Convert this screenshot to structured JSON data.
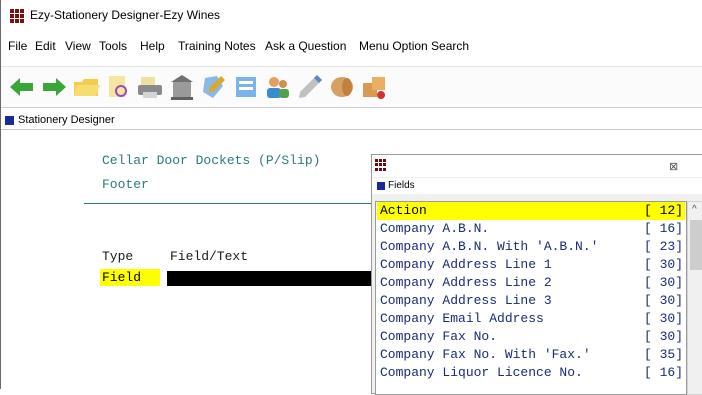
{
  "window": {
    "title": "Ezy-Stationery Designer-Ezy Wines"
  },
  "menu": [
    "File",
    "Edit",
    "View",
    "Tools",
    "Help",
    "Training Notes",
    "Ask a Question",
    "Menu Option Search"
  ],
  "toolbar": {
    "icons": [
      "back-arrow-icon",
      "forward-arrow-icon",
      "folder-icon",
      "search-doc-icon",
      "print-icon",
      "building-icon",
      "edit-icon",
      "document-icon",
      "users-icon",
      "pen-icon",
      "barrel-icon",
      "boxes-icon",
      "tools-icon",
      "bottle-stack-icon",
      "wine-pour-icon",
      "grapes-icon",
      "briefcase-icon",
      "gear-icon",
      "window-icon",
      "barrel2-icon"
    ]
  },
  "mdi": {
    "title": "Stationery Designer"
  },
  "designer": {
    "heading1": "Cellar Door Dockets (P/Slip)",
    "heading2": "Footer",
    "col_type": "Type",
    "col_field": "Field/Text",
    "type_value": "Field"
  },
  "popup": {
    "close": "⊠",
    "subtitle": "Fields",
    "items": [
      {
        "name": "Action",
        "len": "[ 12]"
      },
      {
        "name": "Company A.B.N.",
        "len": "[ 16]"
      },
      {
        "name": "Company A.B.N. With 'A.B.N.'",
        "len": "[ 23]"
      },
      {
        "name": "Company Address Line 1",
        "len": "[ 30]"
      },
      {
        "name": "Company Address Line 2",
        "len": "[ 30]"
      },
      {
        "name": "Company Address Line 3",
        "len": "[ 30]"
      },
      {
        "name": "Company Email Address",
        "len": "[ 30]"
      },
      {
        "name": "Company Fax No.",
        "len": "[ 30]"
      },
      {
        "name": "Company Fax No. With 'Fax.'",
        "len": "[ 35]"
      },
      {
        "name": "Company Liquor Licence No.",
        "len": "[ 16]"
      }
    ],
    "scroll_up": "^"
  }
}
